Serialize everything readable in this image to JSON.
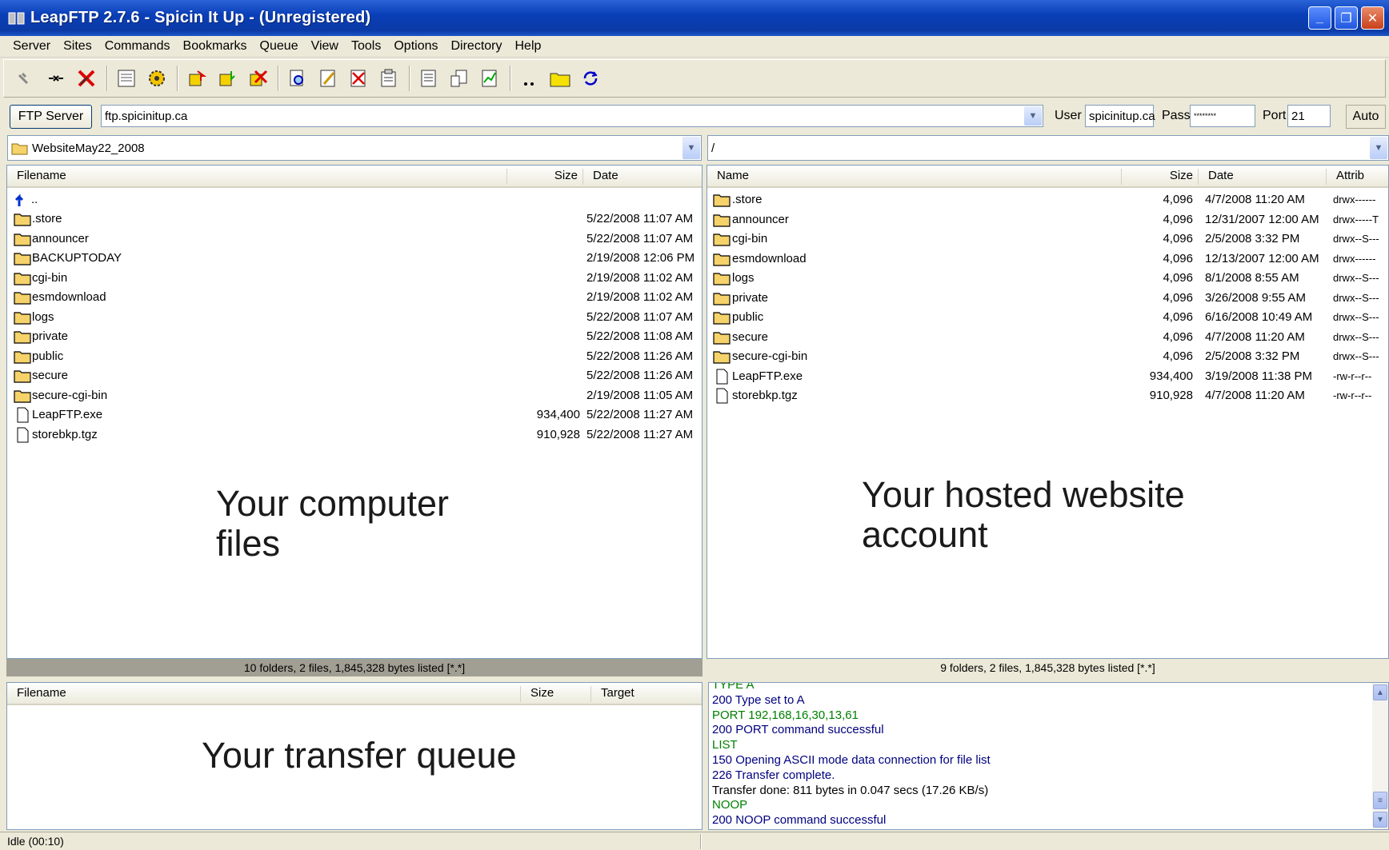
{
  "window": {
    "title": "LeapFTP 2.7.6 - Spicin It Up - (Unregistered)",
    "controls": [
      "minimize",
      "restore",
      "close"
    ]
  },
  "menu": [
    "Server",
    "Sites",
    "Commands",
    "Bookmarks",
    "Queue",
    "View",
    "Tools",
    "Options",
    "Directory",
    "Help"
  ],
  "toolbar": {
    "icons": [
      "connect-icon",
      "disconnect-icon",
      "abort-icon",
      "site-manager-icon",
      "site-settings-icon",
      "upload-icon",
      "download-icon",
      "delete-queue-icon",
      "find-icon",
      "edit-icon",
      "delete-icon",
      "properties-icon",
      "view-log-icon",
      "transfer-icon",
      "chart-icon",
      "parent-dir-icon",
      "folder-icon",
      "refresh-icon"
    ]
  },
  "connection": {
    "ftp_server_button": "FTP Server",
    "host": "ftp.spicinitup.ca",
    "user_label": "User",
    "user": "spicinitup.ca",
    "pass_label": "Pass",
    "pass": "********",
    "port_label": "Port",
    "port": "21",
    "auto_button": "Auto"
  },
  "local": {
    "path": "WebsiteMay22_2008",
    "headers": {
      "name": "Filename",
      "size": "Size",
      "date": "Date"
    },
    "up": "..",
    "files": [
      {
        "name": ".store",
        "type": "folder",
        "size": "",
        "date": "5/22/2008 11:07 AM"
      },
      {
        "name": "announcer",
        "type": "folder",
        "size": "",
        "date": "5/22/2008 11:07 AM"
      },
      {
        "name": "BACKUPTODAY",
        "type": "folder",
        "size": "",
        "date": "2/19/2008 12:06 PM"
      },
      {
        "name": "cgi-bin",
        "type": "folder",
        "size": "",
        "date": "2/19/2008 11:02 AM"
      },
      {
        "name": "esmdownload",
        "type": "folder",
        "size": "",
        "date": "2/19/2008 11:02 AM"
      },
      {
        "name": "logs",
        "type": "folder",
        "size": "",
        "date": "5/22/2008 11:07 AM"
      },
      {
        "name": "private",
        "type": "folder",
        "size": "",
        "date": "5/22/2008 11:08 AM"
      },
      {
        "name": "public",
        "type": "folder",
        "size": "",
        "date": "5/22/2008 11:26 AM"
      },
      {
        "name": "secure",
        "type": "folder",
        "size": "",
        "date": "5/22/2008 11:26 AM"
      },
      {
        "name": "secure-cgi-bin",
        "type": "folder",
        "size": "",
        "date": "2/19/2008 11:05 AM"
      },
      {
        "name": "LeapFTP.exe",
        "type": "file",
        "size": "934,400",
        "date": "5/22/2008 11:27 AM"
      },
      {
        "name": "storebkp.tgz",
        "type": "file",
        "size": "910,928",
        "date": "5/22/2008 11:27 AM"
      }
    ],
    "status": "10 folders, 2 files, 1,845,328 bytes listed [*.*]",
    "annotation": [
      "Your computer",
      "files"
    ]
  },
  "remote": {
    "path": "/",
    "headers": {
      "name": "Name",
      "size": "Size",
      "date": "Date",
      "attrib": "Attrib"
    },
    "files": [
      {
        "name": ".store",
        "type": "folder",
        "size": "4,096",
        "date": "4/7/2008 11:20 AM",
        "attrib": "drwx------"
      },
      {
        "name": "announcer",
        "type": "folder",
        "size": "4,096",
        "date": "12/31/2007 12:00 AM",
        "attrib": "drwx-----T"
      },
      {
        "name": "cgi-bin",
        "type": "folder",
        "size": "4,096",
        "date": "2/5/2008 3:32 PM",
        "attrib": "drwx--S---"
      },
      {
        "name": "esmdownload",
        "type": "folder",
        "size": "4,096",
        "date": "12/13/2007 12:00 AM",
        "attrib": "drwx------"
      },
      {
        "name": "logs",
        "type": "folder",
        "size": "4,096",
        "date": "8/1/2008 8:55 AM",
        "attrib": "drwx--S---"
      },
      {
        "name": "private",
        "type": "folder",
        "size": "4,096",
        "date": "3/26/2008 9:55 AM",
        "attrib": "drwx--S---"
      },
      {
        "name": "public",
        "type": "folder",
        "size": "4,096",
        "date": "6/16/2008 10:49 AM",
        "attrib": "drwx--S---"
      },
      {
        "name": "secure",
        "type": "folder",
        "size": "4,096",
        "date": "4/7/2008 11:20 AM",
        "attrib": "drwx--S---"
      },
      {
        "name": "secure-cgi-bin",
        "type": "folder",
        "size": "4,096",
        "date": "2/5/2008 3:32 PM",
        "attrib": "drwx--S---"
      },
      {
        "name": "LeapFTP.exe",
        "type": "file",
        "size": "934,400",
        "date": "3/19/2008 11:38 PM",
        "attrib": "-rw-r--r--"
      },
      {
        "name": "storebkp.tgz",
        "type": "file",
        "size": "910,928",
        "date": "4/7/2008 11:20 AM",
        "attrib": "-rw-r--r--"
      }
    ],
    "status": "9 folders, 2 files, 1,845,328 bytes listed [*.*]",
    "annotation": [
      "Your hosted website",
      "account"
    ]
  },
  "queue": {
    "headers": {
      "name": "Filename",
      "size": "Size",
      "target": "Target"
    },
    "annotation": "Your transfer queue"
  },
  "log": [
    {
      "text": "TYPE A",
      "color": "#008000"
    },
    {
      "text": "200 Type set to A",
      "color": "#000080"
    },
    {
      "text": "PORT 192,168,16,30,13,61",
      "color": "#008000"
    },
    {
      "text": "200 PORT command successful",
      "color": "#000080"
    },
    {
      "text": "LIST",
      "color": "#008000"
    },
    {
      "text": "150 Opening ASCII mode data connection for file list",
      "color": "#000080"
    },
    {
      "text": "226 Transfer complete.",
      "color": "#000080"
    },
    {
      "text": "Transfer done: 811 bytes in 0.047 secs (17.26 KB/s)",
      "color": "#000000"
    },
    {
      "text": "NOOP",
      "color": "#008000"
    },
    {
      "text": "200 NOOP command successful",
      "color": "#000080"
    }
  ],
  "statusbar": {
    "text": "Idle (00:10)"
  }
}
